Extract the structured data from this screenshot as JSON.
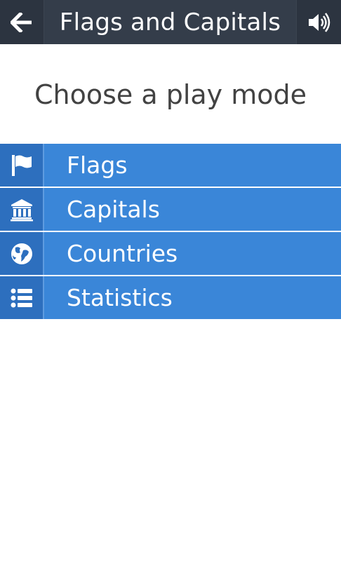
{
  "header": {
    "title": "Flags and Capitals",
    "back_icon": "arrow-left-icon",
    "sound_icon": "speaker-volume-icon"
  },
  "main": {
    "heading": "Choose a play mode"
  },
  "menu": {
    "items": [
      {
        "label": "Flags",
        "icon": "flag-icon"
      },
      {
        "label": "Capitals",
        "icon": "bank-building-icon"
      },
      {
        "label": "Countries",
        "icon": "globe-icon"
      },
      {
        "label": "Statistics",
        "icon": "list-icon"
      }
    ]
  },
  "colors": {
    "topbar": "#2c3440",
    "menu_label_bg": "#3a86d8",
    "menu_icon_bg": "#2d6fbe",
    "heading_text": "#424242"
  }
}
